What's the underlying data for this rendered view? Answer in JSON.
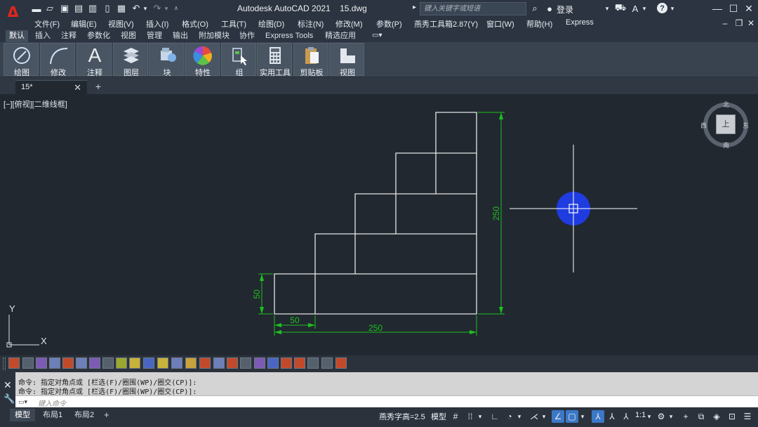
{
  "app": {
    "title": "Autodesk AutoCAD 2021",
    "file": "15.dwg",
    "logo_letter": "A"
  },
  "titlebar": {
    "search_placeholder": "键入关键字或短语",
    "login_label": "登录",
    "help_label": "?"
  },
  "menu": [
    "文件(F)",
    "编辑(E)",
    "视图(V)",
    "插入(I)",
    "格式(O)",
    "工具(T)",
    "绘图(D)",
    "标注(N)",
    "修改(M)",
    "参数(P)",
    "燕秀工具箱2.87(Y)",
    "窗口(W)",
    "帮助(H)",
    "Express"
  ],
  "ribbon_tabs": [
    "默认",
    "插入",
    "注释",
    "参数化",
    "视图",
    "管理",
    "输出",
    "附加模块",
    "协作",
    "Express Tools",
    "精选应用"
  ],
  "ribbon_panels": [
    {
      "label": "绘图",
      "icon": "draw-icon"
    },
    {
      "label": "修改",
      "icon": "modify-icon"
    },
    {
      "label": "注释",
      "icon": "annotate-icon"
    },
    {
      "label": "图层",
      "icon": "layers-icon"
    },
    {
      "label": "块",
      "icon": "block-icon"
    },
    {
      "label": "特性",
      "icon": "properties-icon"
    },
    {
      "label": "组",
      "icon": "group-icon"
    },
    {
      "label": "实用工具",
      "icon": "utilities-icon"
    },
    {
      "label": "剪贴板",
      "icon": "clipboard-icon"
    },
    {
      "label": "视图",
      "icon": "view-icon"
    }
  ],
  "file_tabs": [
    {
      "label": "15*"
    }
  ],
  "viewport": {
    "label": "[−][俯视][二维线框]",
    "viewcube": {
      "top": "上",
      "north": "北",
      "south": "南",
      "east": "东",
      "west": "西"
    }
  },
  "drawing": {
    "dimensions": [
      {
        "text": "250"
      },
      {
        "text": "50"
      },
      {
        "text": "50"
      },
      {
        "text": "250"
      }
    ],
    "ucs": {
      "x_label": "X",
      "y_label": "Y"
    },
    "colors": {
      "geometry": "#e6e6e6",
      "dimension": "#1fbf1f",
      "crosshair": "#ffffff",
      "pickbox_glow": "#1f3fff"
    }
  },
  "command": {
    "history": [
      "命令: 指定对角点或 [栏选(F)/圈围(WP)/圈交(CP)]:",
      "命令: 指定对角点或 [栏选(F)/圈围(WP)/圈交(CP)]:"
    ],
    "input_placeholder": "键入命令"
  },
  "status": {
    "layout_tabs": [
      "模型",
      "布局1",
      "布局2"
    ],
    "text_height": "燕秀字高=2.5",
    "space": "模型",
    "scale": "1:1"
  }
}
